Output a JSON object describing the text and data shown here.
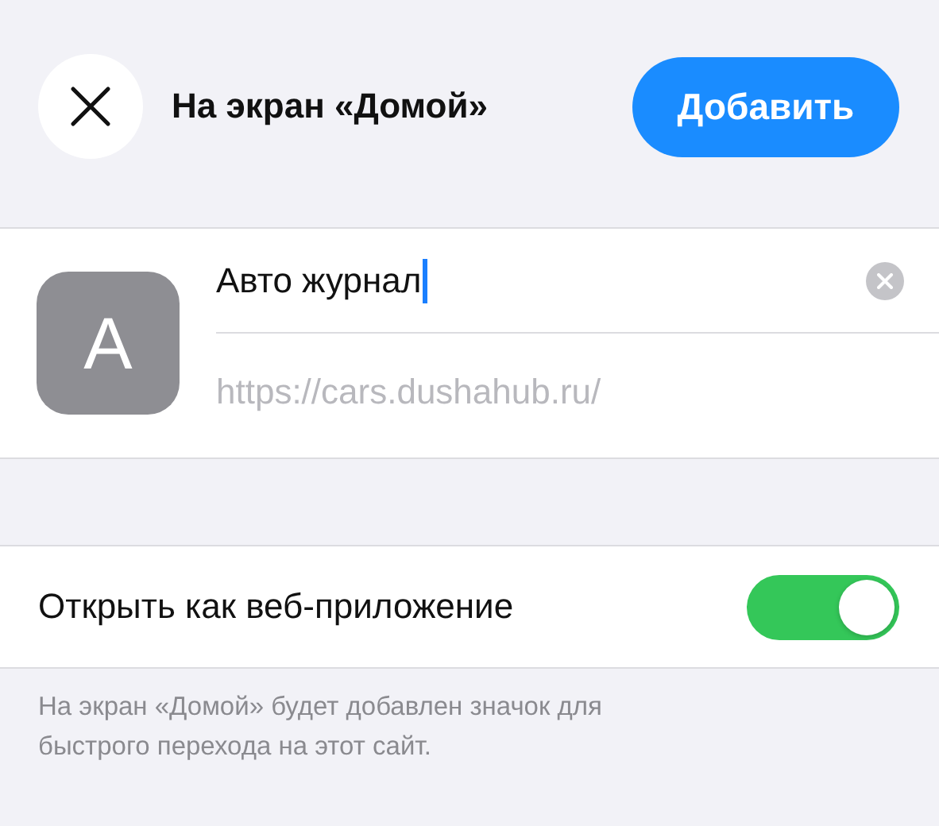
{
  "header": {
    "title": "На экран «Домой»",
    "add_button": "Добавить"
  },
  "bookmark": {
    "icon_letter": "A",
    "name": "Авто журнал",
    "cursor_shown": true,
    "url": "https://cars.dushahub.ru/"
  },
  "web_app": {
    "label": "Открыть как веб-приложение",
    "on": true
  },
  "footer": "На экран «Домой» будет добавлен значок для быстрого перехода на этот сайт."
}
